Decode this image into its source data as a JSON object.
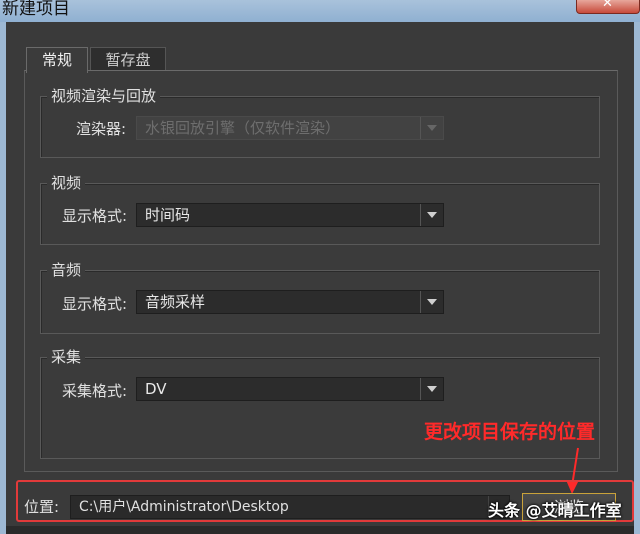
{
  "window": {
    "title": "新建项目",
    "close_glyph": "✕"
  },
  "tabs": [
    {
      "label": "常规",
      "active": true
    },
    {
      "label": "暂存盘",
      "active": false
    }
  ],
  "groups": {
    "video_render": {
      "title": "视频渲染与回放",
      "renderer_label": "渲染器:",
      "renderer_value": "水银回放引擎（仅软件渲染）",
      "renderer_disabled": true
    },
    "video": {
      "title": "视频",
      "format_label": "显示格式:",
      "format_value": "时间码"
    },
    "audio": {
      "title": "音频",
      "format_label": "显示格式:",
      "format_value": "音频采样"
    },
    "capture": {
      "title": "采集",
      "format_label": "采集格式:",
      "format_value": "DV"
    }
  },
  "location": {
    "label": "位置:",
    "path": "C:\\用户\\Administrator\\Desktop",
    "browse_label": "浏览"
  },
  "annotation": {
    "text": "更改项目保存的位置",
    "color": "#ff2a2a"
  },
  "watermark": "头条 @艾晴工作室",
  "icons": {
    "dropdown": "chevron-down-icon"
  }
}
